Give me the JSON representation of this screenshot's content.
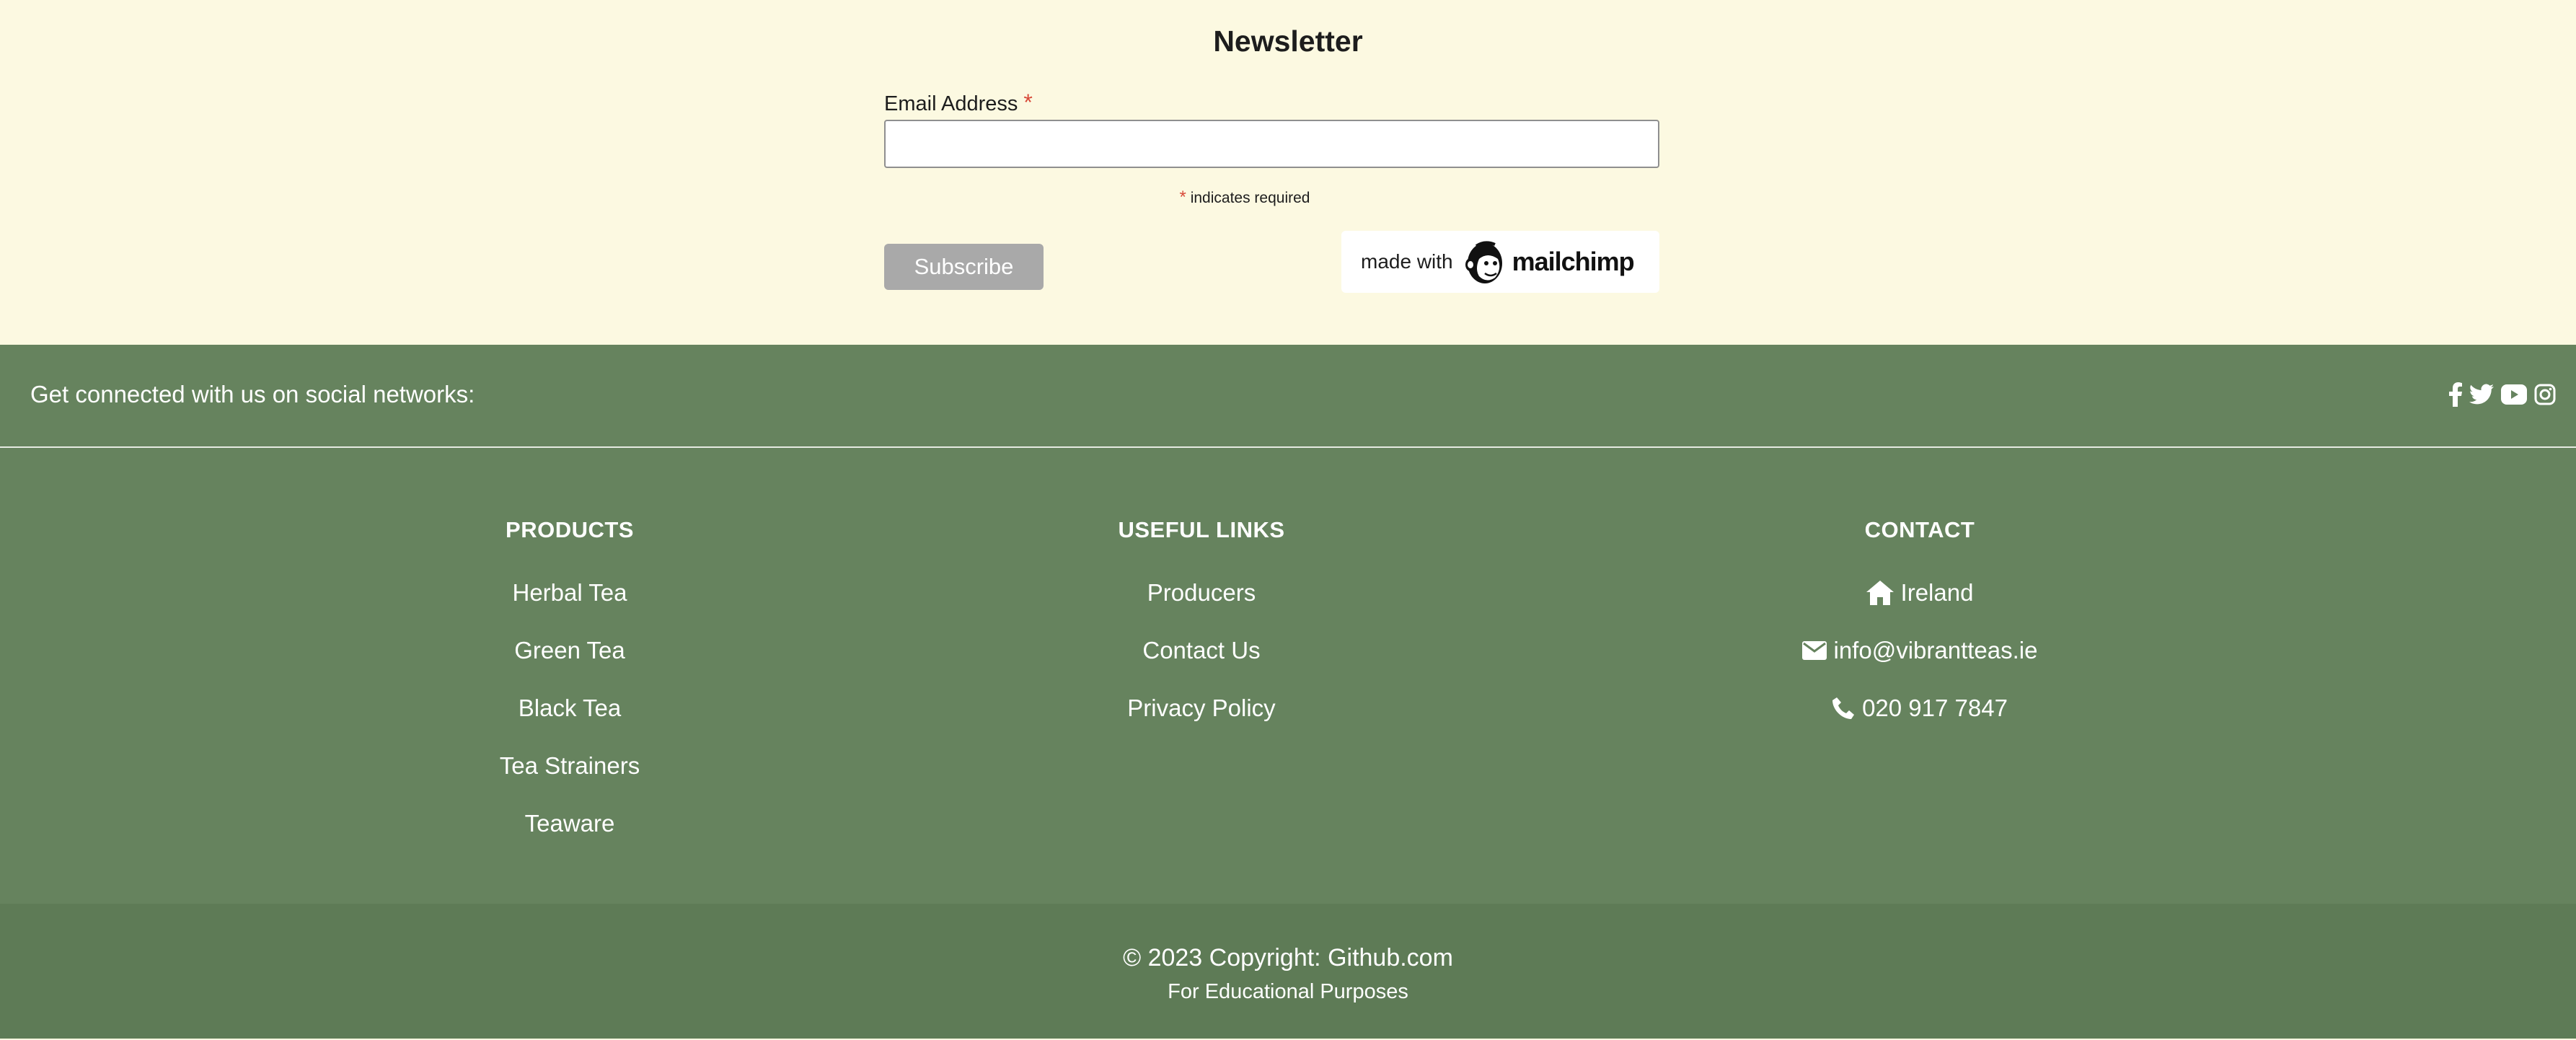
{
  "newsletter": {
    "title": "Newsletter",
    "email_label": "Email Address",
    "required_marker": "*",
    "email_value": "",
    "required_note": "indicates required",
    "subscribe_label": "Subscribe",
    "badge_made_with": "made with",
    "badge_brand": "mailchimp"
  },
  "social": {
    "text": "Get connected with us on social networks:",
    "icons": [
      "facebook-icon",
      "twitter-icon",
      "youtube-icon",
      "instagram-icon"
    ]
  },
  "footer": {
    "products": {
      "title": "PRODUCTS",
      "items": [
        "Herbal Tea",
        "Green Tea",
        "Black Tea",
        "Tea Strainers",
        "Teaware"
      ]
    },
    "useful_links": {
      "title": "USEFUL LINKS",
      "items": [
        "Producers",
        "Contact Us",
        "Privacy Policy"
      ]
    },
    "contact": {
      "title": "CONTACT",
      "address": "Ireland",
      "email": "info@vibrantteas.ie",
      "phone": "020 917 7847"
    }
  },
  "copyright": {
    "main": "© 2023 Copyright: Github.com",
    "sub": "For Educational Purposes"
  },
  "colors": {
    "newsletter_bg": "#fcf9e1",
    "footer_green": "#66835e",
    "copyright_green": "#5e7b56",
    "required_red": "#d84a3a",
    "button_grey": "#a9a9a9"
  }
}
